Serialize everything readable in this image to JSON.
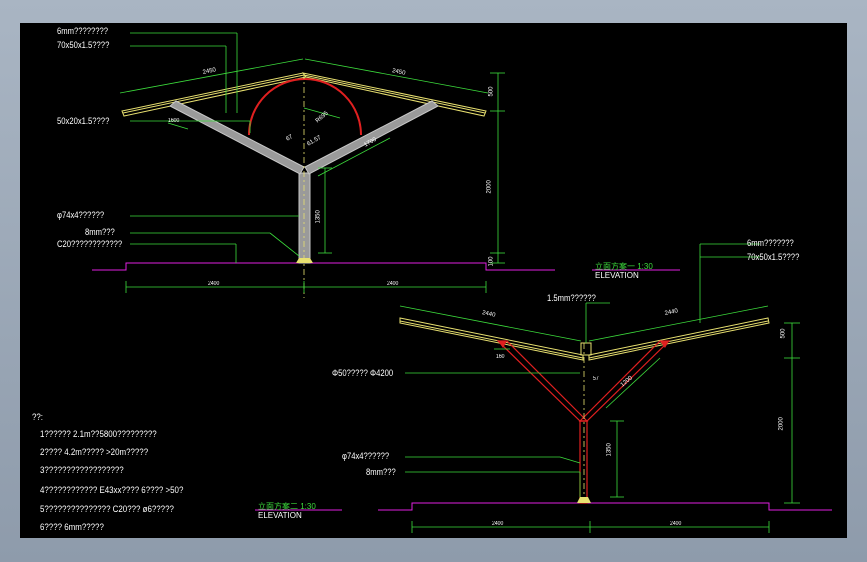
{
  "elevation1": {
    "labels": {
      "l1": "6mm????????",
      "l2": "70x50x1.5????",
      "l3": "50x20x1.5????",
      "l4": "φ74x4??????",
      "l5": "8mm???",
      "l6": "C20????????????"
    },
    "dims": {
      "left_slope": "2450",
      "right_slope": "2450",
      "left_base": "2400",
      "right_base": "2400",
      "h_top": "500",
      "h_total": "2000",
      "h_col": "1350",
      "h_base": "100",
      "arm_left": "1600",
      "arm_right": "1700",
      "arc_r": "R695",
      "angle": "61.57",
      "small": "67"
    },
    "title_cn": "立面方案一  1:30",
    "title_en": "ELEVATION"
  },
  "elevation2": {
    "labels": {
      "l1": "6mm???????",
      "l2": "70x50x1.5????",
      "l3": "1.5mm??????",
      "l4": "Φ50?????  Φ4200",
      "l5": "φ74x4??????",
      "l6": "8mm???"
    },
    "dims": {
      "left_slope": "2440",
      "right_slope": "2440",
      "left_base": "2400",
      "right_base": "2400",
      "h_top": "500",
      "h_total": "2000",
      "h_col": "1350",
      "arm": "1200",
      "small": "160",
      "angle": "57"
    },
    "title_cn": "立面方案二  1:30",
    "title_en": "ELEVATION"
  },
  "notes": {
    "heading": "??:",
    "items": [
      "1??????  2.1m??5800?????????",
      "2????  4.2m?????  >20m?????",
      "3??????????????????",
      "4????????????   E43xx????  6????  >50?",
      "5???????????????   C20???  ø6?????",
      "6????  6mm?????"
    ]
  }
}
